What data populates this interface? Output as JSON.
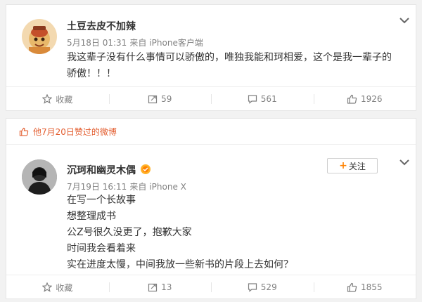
{
  "post1": {
    "author": "土豆去皮不加辣",
    "time": "5月18日 01:31",
    "source_prefix": "来自",
    "source": "iPhone客户端",
    "text": "我这辈子没有什么事情可以骄傲的，唯独我能和珂相爱，这个是我一辈子的骄傲！！！",
    "actions": {
      "favorite_label": "收藏",
      "repost_count": "59",
      "comment_count": "561",
      "like_count": "1926"
    }
  },
  "liked_header": {
    "text": "他7月20日赞过的微博"
  },
  "post2": {
    "author": "沉珂和幽灵木偶",
    "follow_label": "关注",
    "time": "7月19日 16:11",
    "source_prefix": "来自",
    "source": "iPhone X",
    "lines": [
      "在写一个长故事",
      "想整理成书",
      "公Z号很久没更了，抱歉大家",
      "时间我会看着来",
      "实在进度太慢，中间我放一些新书的片段上去如何？"
    ],
    "actions": {
      "favorite_label": "收藏",
      "repost_count": "13",
      "comment_count": "529",
      "like_count": "1855"
    }
  },
  "colors": {
    "accent_orange": "#ff8200",
    "liked_header": "#e35d2f",
    "meta_gray": "#808080"
  },
  "icons": {
    "favorite": "star-icon",
    "repost": "repost-icon",
    "comment": "comment-icon",
    "like": "thumbs-up-icon",
    "menu": "chevron-down-icon",
    "badge": "fan-badge-icon"
  }
}
